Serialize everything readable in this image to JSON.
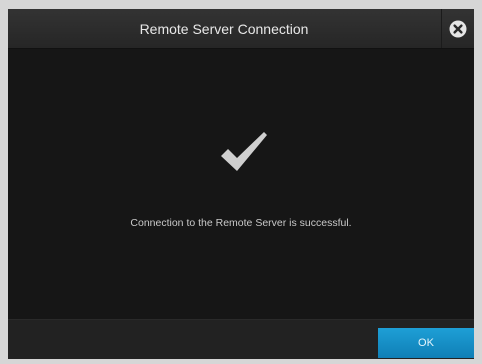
{
  "dialog": {
    "title": "Remote Server Connection",
    "message": "Connection to the Remote Server is successful.",
    "ok_label": "OK"
  },
  "icons": {
    "close": "close-circle-icon",
    "status": "checkmark-icon"
  },
  "colors": {
    "background": "#161616",
    "titlebar": "#2e2e2e",
    "accent": "#1690c8",
    "text": "#c9c9c9"
  }
}
